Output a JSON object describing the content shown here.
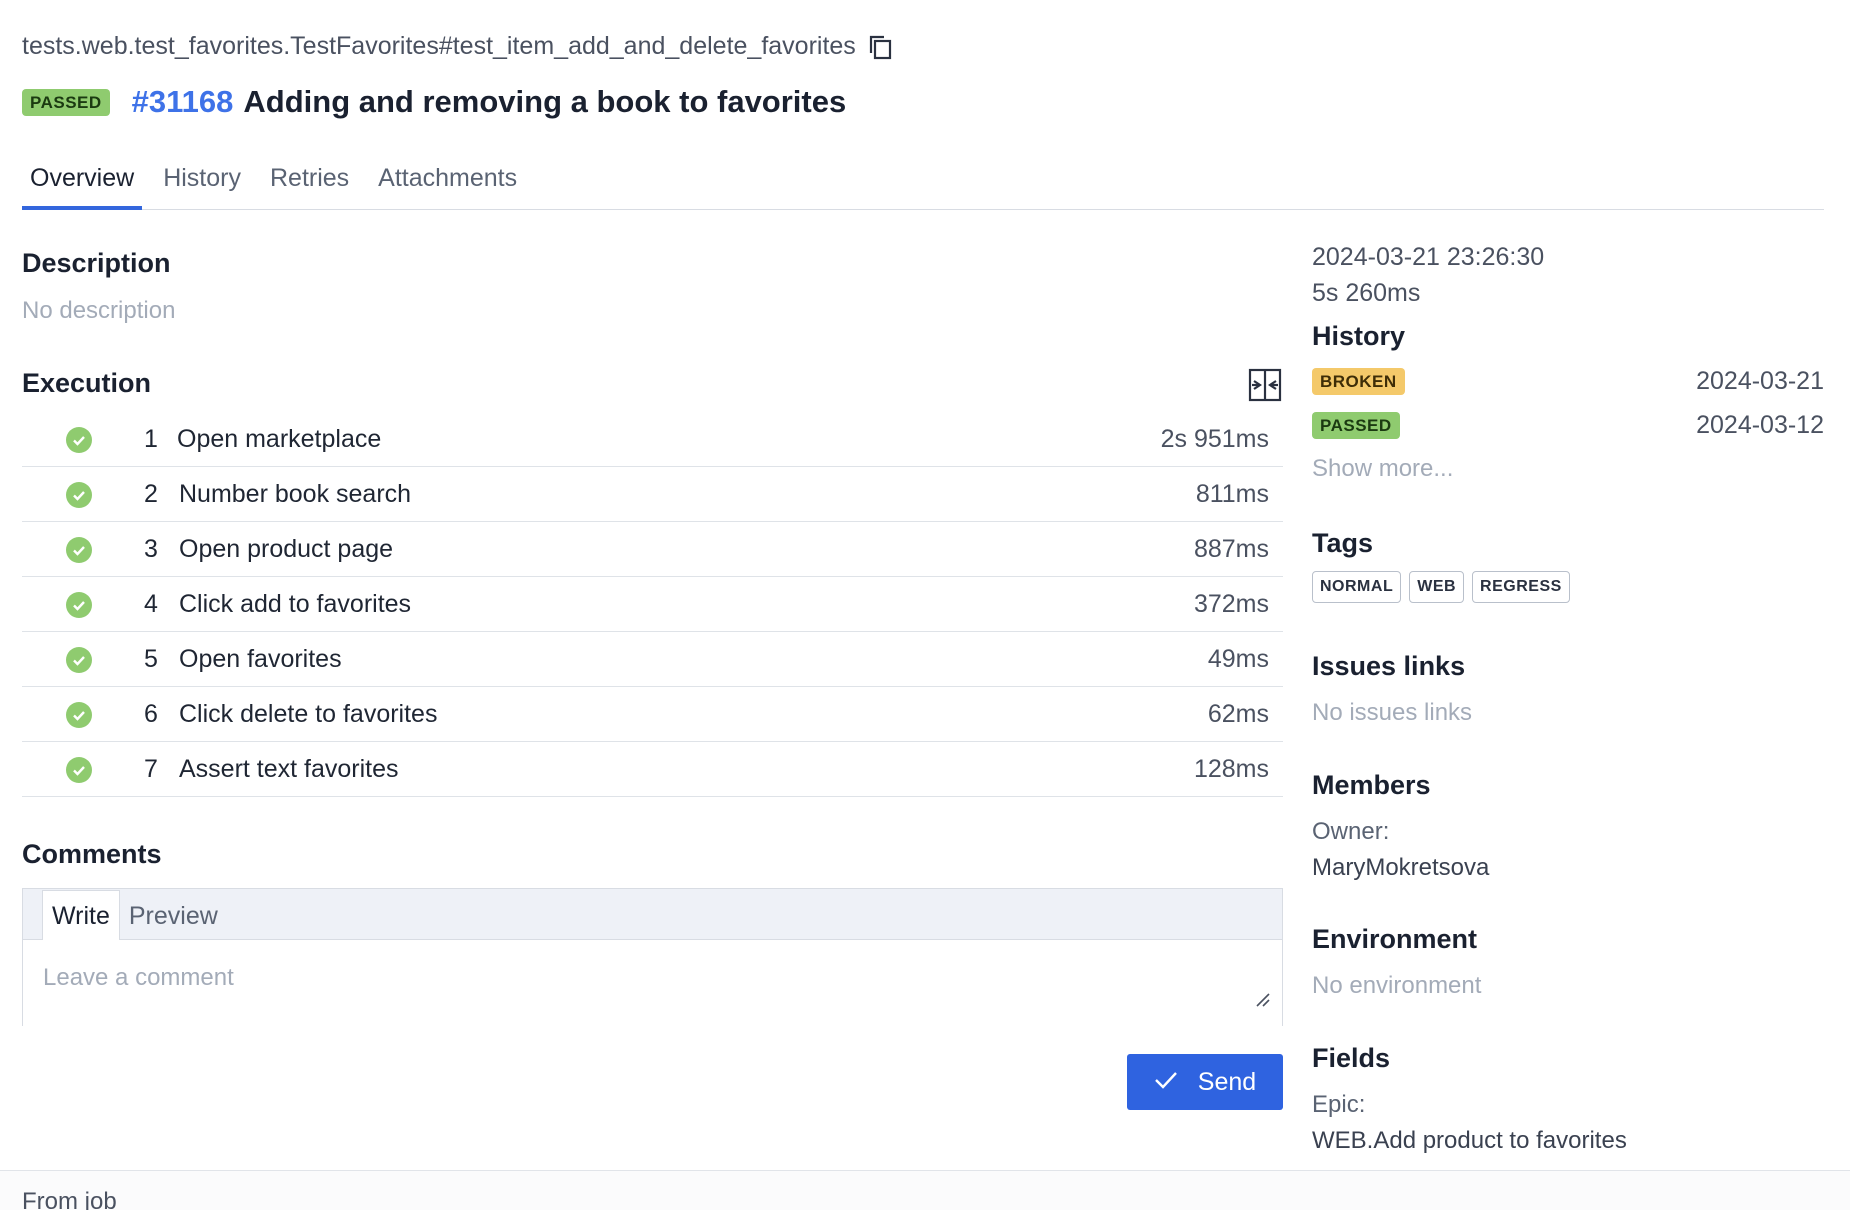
{
  "header": {
    "full_name": "tests.web.test_favorites.TestFavorites#test_item_add_and_delete_favorites",
    "status": "PASSED",
    "test_id": "#31168",
    "title": "Adding and removing a book to favorites"
  },
  "tabs": [
    "Overview",
    "History",
    "Retries",
    "Attachments"
  ],
  "description": {
    "heading": "Description",
    "text": "No description"
  },
  "execution": {
    "heading": "Execution",
    "steps": [
      {
        "num": "1",
        "name": "Open marketplace",
        "duration": "2s 951ms"
      },
      {
        "num": "2",
        "name": "Number book search",
        "duration": "811ms"
      },
      {
        "num": "3",
        "name": "Open product page",
        "duration": "887ms"
      },
      {
        "num": "4",
        "name": "Click add to favorites",
        "duration": "372ms"
      },
      {
        "num": "5",
        "name": "Open favorites",
        "duration": "49ms"
      },
      {
        "num": "6",
        "name": "Click delete to favorites",
        "duration": "62ms"
      },
      {
        "num": "7",
        "name": "Assert text favorites",
        "duration": "128ms"
      }
    ]
  },
  "comments": {
    "heading": "Comments",
    "write_tab": "Write",
    "preview_tab": "Preview",
    "placeholder": "Leave a comment",
    "send_label": "Send"
  },
  "footer": {
    "text": "From job"
  },
  "sidebar": {
    "timestamp": "2024-03-21 23:26:30",
    "duration": "5s 260ms",
    "history_heading": "History",
    "history": [
      {
        "status": "BROKEN",
        "date": "2024-03-21"
      },
      {
        "status": "PASSED",
        "date": "2024-03-12"
      }
    ],
    "show_more": "Show more...",
    "tags_heading": "Tags",
    "tags": [
      "NORMAL",
      "WEB",
      "REGRESS"
    ],
    "issues_heading": "Issues links",
    "issues_text": "No issues links",
    "members_heading": "Members",
    "owner_label": "Owner:",
    "owner_name": "MaryMokretsova",
    "environment_heading": "Environment",
    "environment_text": "No environment",
    "fields_heading": "Fields",
    "epic_label": "Epic:",
    "epic_value": "WEB.Add product to favorites"
  },
  "colors": {
    "accent": "#3366dd",
    "passed": "#8fcb6f",
    "broken": "#f4c96a"
  }
}
